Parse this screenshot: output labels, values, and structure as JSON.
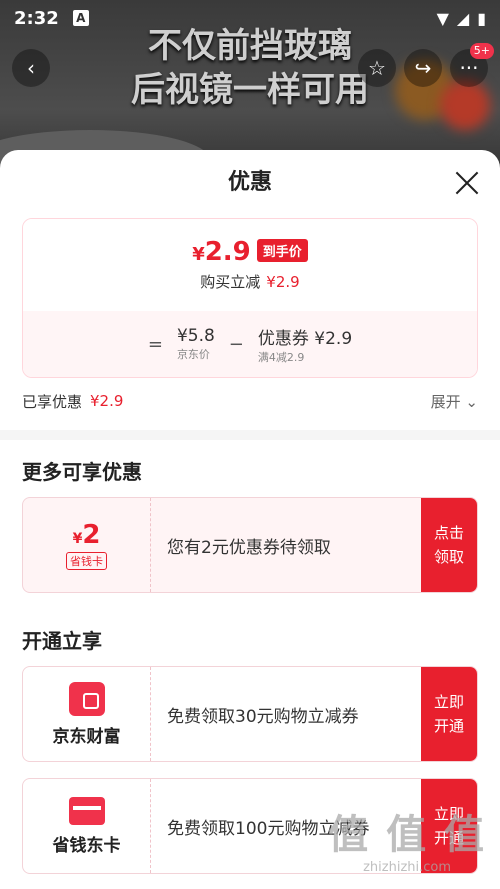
{
  "status": {
    "time": "2:32",
    "badge": "5+"
  },
  "background": {
    "title_line1": "不仅前挡玻璃",
    "title_line2": "后视镜一样可用"
  },
  "sheet": {
    "title": "优惠",
    "price": {
      "amount": "2.9",
      "currency": "¥",
      "tag": "到手价",
      "sub_label": "购买立减",
      "sub_value": "¥2.9"
    },
    "breakdown": {
      "eq": "=",
      "orig_value": "¥5.8",
      "orig_label": "京东价",
      "minus": "−",
      "coupon_label": "优惠券 ¥2.9",
      "coupon_sub": "满4减2.9"
    },
    "enjoyed": {
      "label": "已享优惠",
      "value": "¥2.9",
      "expand": "展开"
    },
    "more_title": "更多可享优惠",
    "coupon1": {
      "currency": "¥",
      "amount": "2",
      "tag": "省钱卡",
      "text": "您有2元优惠券待领取",
      "action": "点击领取"
    },
    "open_title": "开通立享",
    "coupon2": {
      "brand": "京东财富",
      "text": "免费领取30元购物立减券",
      "action": "立即开通"
    },
    "coupon3": {
      "brand": "省钱东卡",
      "text": "免费领取100元购物立减券",
      "action": "立即开通"
    }
  },
  "watermark": {
    "text": "值 值 值",
    "url": "zhizhizhi.com"
  }
}
